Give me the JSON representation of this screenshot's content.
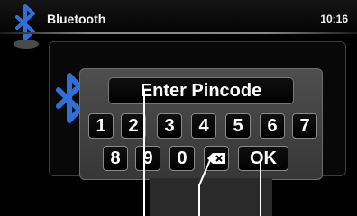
{
  "header": {
    "title": "Bluetooth",
    "clock": "10:16",
    "icon": "bluetooth-icon",
    "accent_color": "#2f6fd6"
  },
  "dialog": {
    "pin_placeholder": "Enter Pincode",
    "keys_row1": [
      "1",
      "2",
      "3",
      "4",
      "5",
      "6",
      "7"
    ],
    "keys_row2": [
      "8",
      "9",
      "0"
    ],
    "backspace_icon": "backspace-icon",
    "ok_label": "OK"
  }
}
